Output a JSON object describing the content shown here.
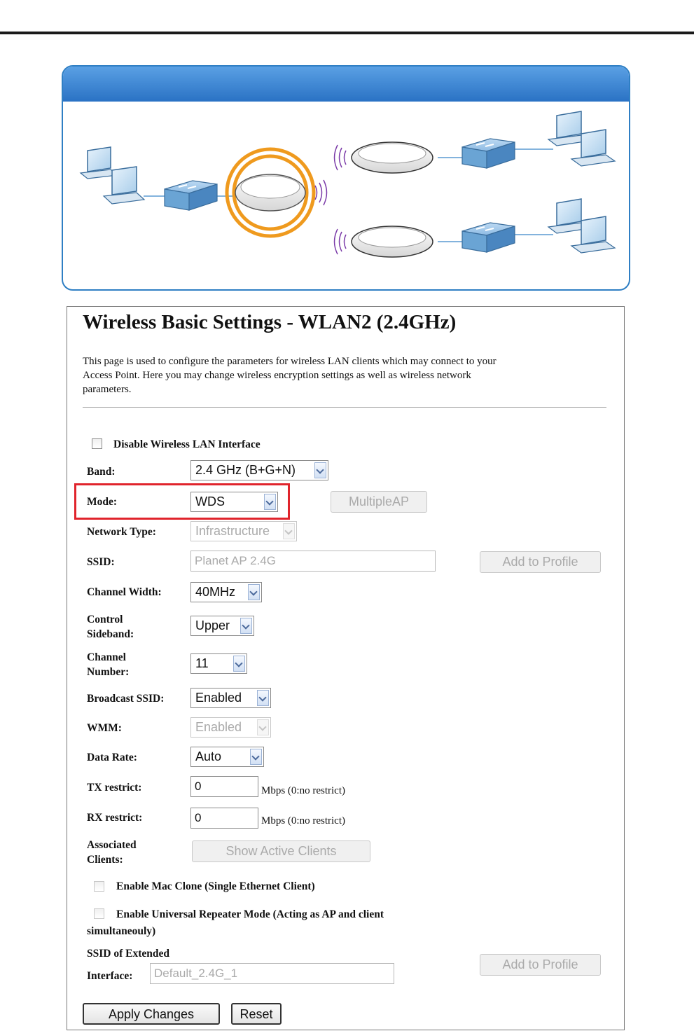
{
  "page_title": "Wireless Basic Settings - WLAN2 (2.4GHz)",
  "description": "This page is used to configure the parameters for wireless LAN clients which may connect to your Access Point. Here you may change wireless encryption settings as well as wireless network parameters.",
  "description_lines": [
    "This page is used to configure the parameters for wireless LAN clients which may connect to your",
    "Access Point. Here you may change wireless encryption settings as well as wireless network",
    "parameters."
  ],
  "disable_wlan": {
    "label": "Disable Wireless LAN Interface",
    "checked": false
  },
  "band": {
    "label": "Band:",
    "value": "2.4 GHz (B+G+N)"
  },
  "mode": {
    "label": "Mode:",
    "value": "WDS",
    "multiple_ap_button": "MultipleAP",
    "highlight_color": "#e0242c"
  },
  "network_type": {
    "label": "Network Type:",
    "value": "Infrastructure",
    "disabled": true
  },
  "ssid": {
    "label": "SSID:",
    "value": "Planet AP 2.4G",
    "add_profile_button": "Add to Profile"
  },
  "channel_width": {
    "label": "Channel Width:",
    "value": "40MHz"
  },
  "control_sideband": {
    "label_line1": "Control",
    "label_line2": "Sideband:",
    "value": "Upper"
  },
  "channel_number": {
    "label_line1": "Channel",
    "label_line2": "Number:",
    "value": "11"
  },
  "broadcast_ssid": {
    "label": "Broadcast SSID:",
    "value": "Enabled"
  },
  "wmm": {
    "label": "WMM:",
    "value": "Enabled",
    "disabled": true
  },
  "data_rate": {
    "label": "Data Rate:",
    "value": "Auto"
  },
  "tx_restrict": {
    "label": "TX restrict:",
    "value": "0",
    "unit": "Mbps (0:no restrict)"
  },
  "rx_restrict": {
    "label": "RX restrict:",
    "value": "0",
    "unit": "Mbps (0:no restrict)"
  },
  "associated_clients": {
    "label_line1": "Associated",
    "label_line2": "Clients:",
    "button": "Show Active Clients"
  },
  "mac_clone": {
    "label": "Enable Mac Clone (Single Ethernet Client)",
    "checked": false
  },
  "universal_repeater": {
    "label_line1": "Enable Universal Repeater Mode (Acting as AP and client",
    "label_line2": "simultaneouly)",
    "checked": false
  },
  "extended_ssid": {
    "label_line1": "SSID of Extended",
    "label_line2": "Interface:",
    "value": "Default_2.4G_1",
    "add_profile_button": "Add to Profile"
  },
  "buttons": {
    "apply": "Apply Changes",
    "reset": "Reset"
  },
  "colors": {
    "diagram_border": "#2f7fc4",
    "diagram_header": "#3a86d4",
    "access_point_ring": "#ef9a1e",
    "signal_waves": "#7a3aa8",
    "switch_blue": "#6aa4d4"
  },
  "diagram": {
    "icons": [
      "laptop-icon",
      "switch-icon",
      "access-point-icon",
      "wireless-signal-icon"
    ],
    "description": "WDS network topology"
  }
}
